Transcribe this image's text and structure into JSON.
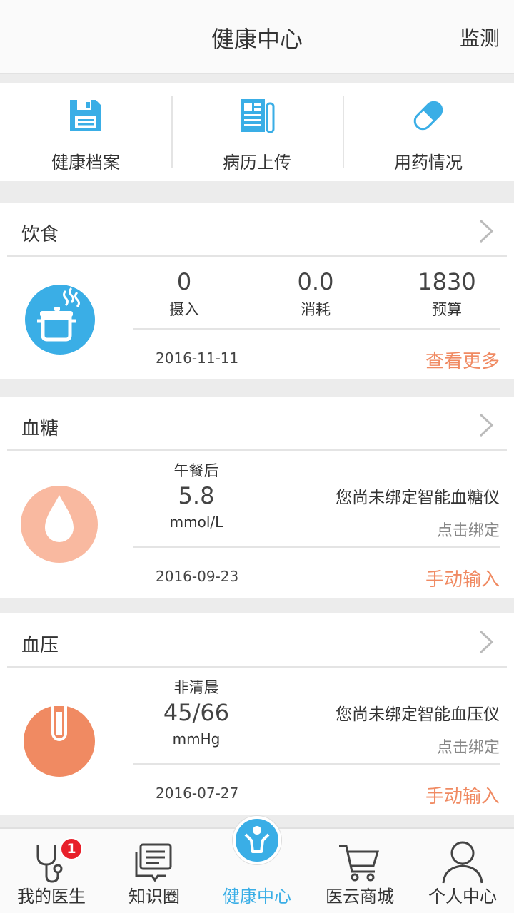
{
  "header": {
    "title": "健康中心",
    "action": "监测"
  },
  "quick_actions": [
    {
      "label": "健康档案",
      "icon": "floppy-disk-icon"
    },
    {
      "label": "病历上传",
      "icon": "newspaper-icon"
    },
    {
      "label": "用药情况",
      "icon": "pill-icon"
    }
  ],
  "diet": {
    "title": "饮食",
    "icon": "cooking-pot-icon",
    "stats": [
      {
        "value": "0",
        "label": "摄入"
      },
      {
        "value": "0.0",
        "label": "消耗"
      },
      {
        "value": "1830",
        "label": "预算"
      }
    ],
    "date": "2016-11-11",
    "more": "查看更多"
  },
  "blood_sugar": {
    "title": "血糖",
    "icon": "blood-drop-icon",
    "period": "午餐后",
    "value": "5.8",
    "unit": "mmol/L",
    "device_status": "您尚未绑定智能血糖仪",
    "bind": "点击绑定",
    "date": "2016-09-23",
    "manual": "手动输入"
  },
  "blood_pressure": {
    "title": "血压",
    "icon": "thermometer-icon",
    "period": "非清晨",
    "value": "45/66",
    "unit": "mmHg",
    "device_status": "您尚未绑定智能血压仪",
    "bind": "点击绑定",
    "date": "2016-07-27",
    "manual": "手动输入"
  },
  "nav": {
    "items": [
      {
        "label": "我的医生",
        "icon": "stethoscope-icon",
        "badge": "1"
      },
      {
        "label": "知识圈",
        "icon": "chat-bubble-icon"
      },
      {
        "label": "健康中心",
        "icon": "person-icon",
        "active": true
      },
      {
        "label": "医云商城",
        "icon": "shopping-cart-icon"
      },
      {
        "label": "个人中心",
        "icon": "user-icon"
      }
    ]
  },
  "colors": {
    "accent": "#3aaee6",
    "orange": "#f08a62",
    "salmon": "#f9b9a0",
    "badge": "#e8202a"
  }
}
